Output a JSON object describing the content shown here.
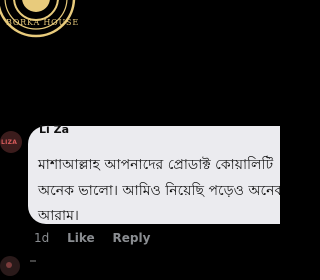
{
  "brand": {
    "logo_text": "BORKA HOUSE",
    "logo_color": "#e8cb7c"
  },
  "comment": {
    "avatar_text": "LIZA",
    "author": "Li Za",
    "lines": [
      "মাশাআল্লাহ আপনাদের প্রোডাক্ট কোয়ালিটি",
      "অনেক ভালো। আমিও নিয়েছি পড়েও অনেক",
      "আরাম।"
    ],
    "time": "1d",
    "like_label": "Like",
    "reply_label": "Reply"
  }
}
